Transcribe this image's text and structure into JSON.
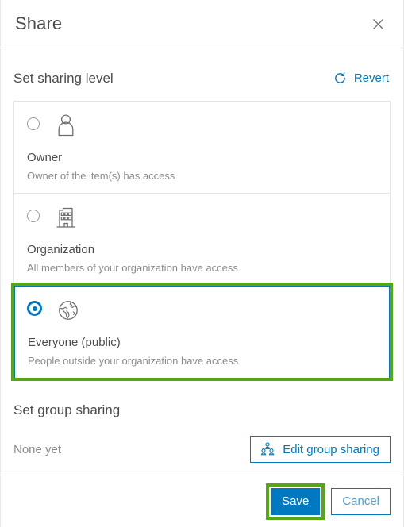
{
  "dialog": {
    "title": "Share",
    "close_icon": "close-icon"
  },
  "sharing_level": {
    "section_title": "Set sharing level",
    "revert_label": "Revert",
    "revert_icon": "revert-circular-arrow-icon",
    "options": [
      {
        "id": "owner",
        "label": "Owner",
        "description": "Owner of the item(s) has access",
        "icon": "person-icon",
        "selected": false
      },
      {
        "id": "organization",
        "label": "Organization",
        "description": "All members of your organization have access",
        "icon": "building-icon",
        "selected": false
      },
      {
        "id": "everyone",
        "label": "Everyone (public)",
        "description": "People outside your organization have access",
        "icon": "globe-icon",
        "selected": true
      }
    ]
  },
  "group_sharing": {
    "section_title": "Set group sharing",
    "status": "None yet",
    "edit_button_label": "Edit group sharing",
    "edit_button_icon": "group-people-icon"
  },
  "footer": {
    "save_label": "Save",
    "cancel_label": "Cancel"
  },
  "colors": {
    "accent_blue": "#0079c1",
    "highlight_green": "#57a616",
    "text_dark": "#4c4c4c",
    "text_muted": "#8c8c8c",
    "divider": "#e4e4e4"
  }
}
